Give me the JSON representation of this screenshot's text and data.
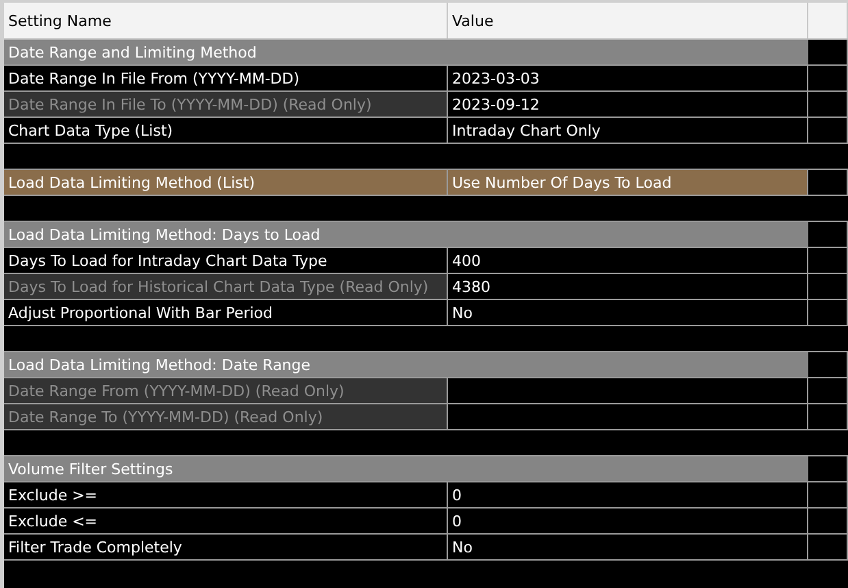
{
  "table": {
    "columns": [
      "Setting Name",
      "Value"
    ],
    "rows": [
      {
        "kind": "section",
        "label": "Date Range and Limiting Method"
      },
      {
        "kind": "setting",
        "label": "Date Range In File From (YYYY-MM-DD)",
        "value": "2023-03-03",
        "read_only": false,
        "selected": false
      },
      {
        "kind": "setting",
        "label": "Date Range In File To (YYYY-MM-DD) (Read Only)",
        "value": "2023-09-12",
        "read_only": true,
        "selected": false
      },
      {
        "kind": "setting",
        "label": "Chart Data Type (List)",
        "value": "Intraday Chart Only",
        "read_only": false,
        "selected": false
      },
      {
        "kind": "blank"
      },
      {
        "kind": "setting",
        "label": "Load Data Limiting Method (List)",
        "value": "Use Number Of Days To Load",
        "read_only": false,
        "selected": true
      },
      {
        "kind": "blank"
      },
      {
        "kind": "section",
        "label": "Load Data Limiting Method: Days to Load"
      },
      {
        "kind": "setting",
        "label": "Days To Load for Intraday Chart Data Type",
        "value": "400",
        "read_only": false,
        "selected": false
      },
      {
        "kind": "setting",
        "label": "Days To Load for Historical Chart Data Type (Read Only)",
        "value": "4380",
        "read_only": true,
        "selected": false
      },
      {
        "kind": "setting",
        "label": "Adjust Proportional With Bar Period",
        "value": "No",
        "read_only": false,
        "selected": false
      },
      {
        "kind": "blank"
      },
      {
        "kind": "section",
        "label": "Load Data Limiting Method: Date Range"
      },
      {
        "kind": "setting",
        "label": "Date Range From (YYYY-MM-DD) (Read Only)",
        "read_only": true,
        "selected": false
      },
      {
        "kind": "setting",
        "label": "Date Range To (YYYY-MM-DD) (Read Only)",
        "read_only": true,
        "selected": false
      },
      {
        "kind": "blank"
      },
      {
        "kind": "section",
        "label": "Volume Filter Settings"
      },
      {
        "kind": "setting",
        "label": "Exclude >=",
        "value": "0",
        "read_only": false,
        "selected": false
      },
      {
        "kind": "setting",
        "label": "Exclude <=",
        "value": "0",
        "read_only": false,
        "selected": false
      },
      {
        "kind": "setting",
        "label": "Filter Trade Completely",
        "value": "No",
        "read_only": false,
        "selected": false
      }
    ]
  }
}
